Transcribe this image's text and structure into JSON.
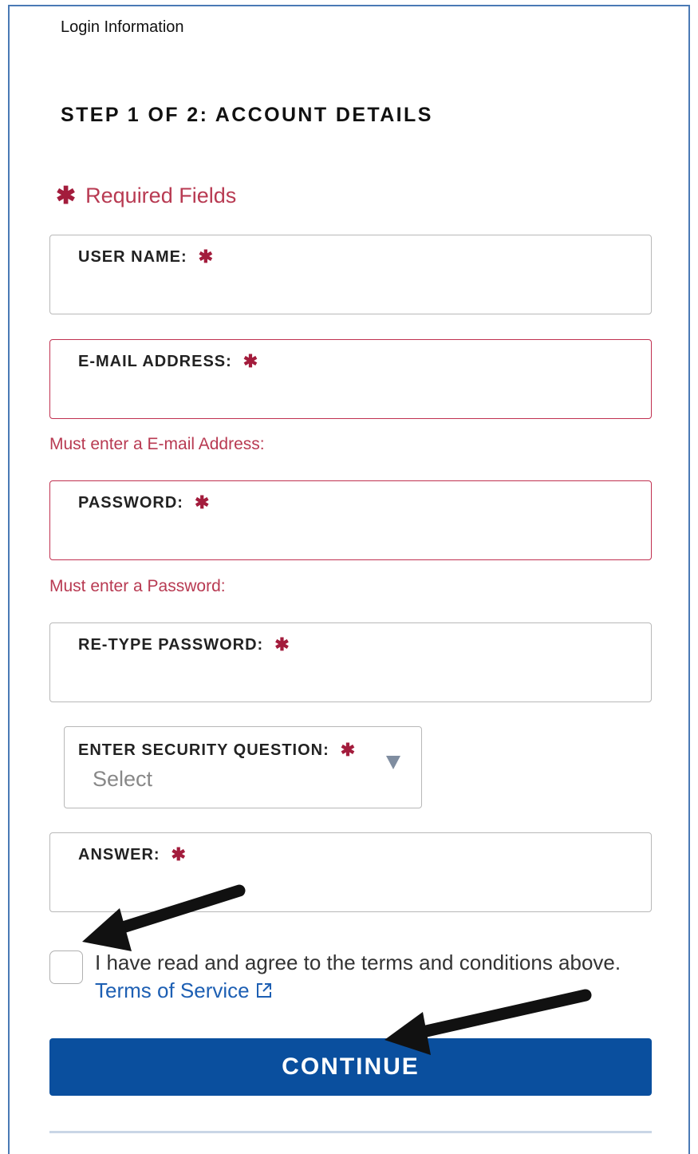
{
  "header": {
    "section_label": "Login Information"
  },
  "step": {
    "title": "STEP 1 OF 2: ACCOUNT DETAILS"
  },
  "required_note": {
    "star": "✱",
    "text": "Required Fields"
  },
  "fields": {
    "username": {
      "label": "USER NAME:",
      "value": ""
    },
    "email": {
      "label": "E-MAIL ADDRESS:",
      "value": "",
      "error": "Must enter a E-mail Address:"
    },
    "password": {
      "label": "PASSWORD:",
      "value": "",
      "error": "Must enter a Password:"
    },
    "retype_password": {
      "label": "RE-TYPE PASSWORD:",
      "value": ""
    },
    "security_question": {
      "label": "ENTER SECURITY QUESTION:",
      "selected": "Select"
    },
    "answer": {
      "label": "ANSWER:",
      "value": ""
    }
  },
  "required_star": "✱",
  "terms": {
    "text": "I have read and agree to the terms and conditions above.",
    "link": "Terms of Service",
    "checked": false
  },
  "continue_label": "CONTINUE",
  "icons": {
    "external_link": "external-link-icon",
    "required": "asterisk-icon",
    "dropdown": "caret-down-icon"
  },
  "colors": {
    "accent": "#0a4f9e",
    "error": "#b83a52",
    "link": "#1d5fb3"
  }
}
